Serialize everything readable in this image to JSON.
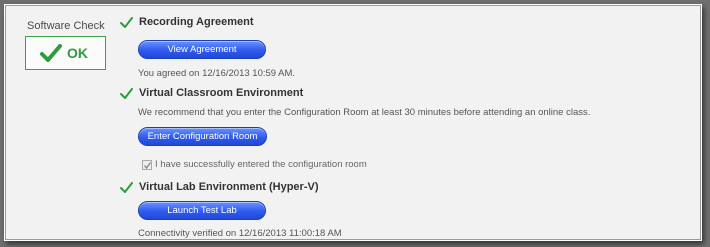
{
  "status_panel": {
    "label": "Software Check",
    "status_text": "OK",
    "accent_color": "#2e9b3d"
  },
  "sections": {
    "recording": {
      "title": "Recording Agreement",
      "button": "View Agreement",
      "note": "You agreed on 12/16/2013 10:59 AM."
    },
    "classroom": {
      "title": "Virtual Classroom Environment",
      "note": "We recommend that you enter the Configuration Room at least 30 minutes before attending an online class.",
      "button": "Enter Configuration Room",
      "checkbox_label": "I have successfully entered the configuration room",
      "checkbox_checked": true
    },
    "lab": {
      "title": "Virtual Lab Environment (Hyper-V)",
      "button": "Launch Test Lab",
      "note": "Connectivity verified on 12/16/2013 11:00:18 AM"
    }
  }
}
